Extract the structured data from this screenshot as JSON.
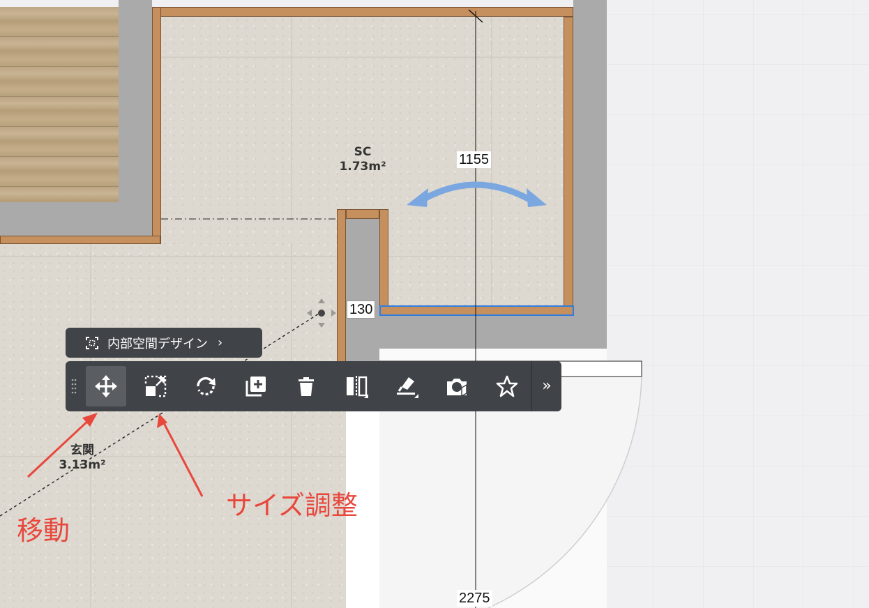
{
  "dimensions": {
    "top": "1155",
    "selected": "130",
    "bottom": "2275"
  },
  "rooms": [
    {
      "name": "SC",
      "area": "1.73m²"
    },
    {
      "name": "玄関",
      "area": "3.13m²"
    }
  ],
  "context_pill": {
    "label": "内部空間デザイン",
    "icon": "select-region-icon",
    "arrow": "›"
  },
  "toolbar": {
    "items": [
      {
        "id": "move",
        "icon": "move-icon",
        "active": true
      },
      {
        "id": "resize",
        "icon": "resize-icon"
      },
      {
        "id": "rotate",
        "icon": "rotate-icon"
      },
      {
        "id": "duplicate",
        "icon": "duplicate-icon"
      },
      {
        "id": "delete",
        "icon": "trash-icon"
      },
      {
        "id": "flip",
        "icon": "flip-icon"
      },
      {
        "id": "material",
        "icon": "paint-icon"
      },
      {
        "id": "camera",
        "icon": "camera-3d-icon"
      },
      {
        "id": "favorite",
        "icon": "star-icon"
      }
    ],
    "more": "»"
  },
  "annotations": {
    "move": "移動",
    "resize": "サイズ調整"
  },
  "colors": {
    "annotation": "#e8473c",
    "selection": "#2f7de1",
    "rotate_arrow": "#7aa7e0",
    "toolbar_bg": "#404347"
  }
}
